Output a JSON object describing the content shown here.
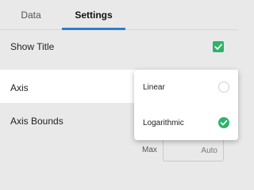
{
  "tabs": [
    {
      "label": "Data",
      "active": false
    },
    {
      "label": "Settings",
      "active": true
    }
  ],
  "settings": {
    "show_title": {
      "label": "Show Title",
      "checked": true
    },
    "axis": {
      "label": "Axis",
      "selected": "Logarithmic"
    },
    "axis_bounds": {
      "label": "Axis Bounds",
      "max_label": "Max",
      "max_value": "Auto"
    }
  },
  "axis_menu": {
    "options": [
      {
        "label": "Linear",
        "selected": false
      },
      {
        "label": "Logarithmic",
        "selected": true
      }
    ]
  },
  "colors": {
    "accent": "#2e7fd0",
    "check": "#2eb36b"
  },
  "icons": {
    "checkbox": "checkmark-icon",
    "radio_selected": "check-circle-icon",
    "radio_unselected": "empty-circle-icon"
  }
}
